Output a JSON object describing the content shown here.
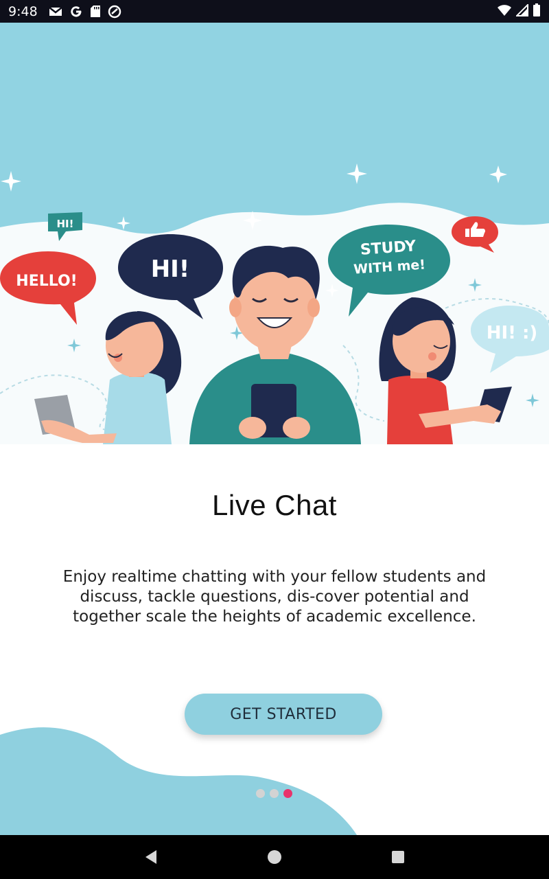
{
  "status_bar": {
    "time": "9:48",
    "left_icons": [
      "gmail-icon",
      "google-icon",
      "sd-card-icon",
      "sync-icon"
    ],
    "right_icons": [
      "wifi-icon",
      "signal-icon",
      "battery-icon"
    ]
  },
  "hero": {
    "bubbles": {
      "hello": "HELLO!",
      "hi_small": "HI!",
      "hi_big": "HI!",
      "study_line1": "STUDY",
      "study_line2": "WITH me!",
      "hi_smile": "HI! :)"
    },
    "icons": [
      "thumbs-up-icon"
    ]
  },
  "onboarding": {
    "title": "Live Chat",
    "description": "Enjoy realtime chatting with your fellow students and discuss, tackle questions, dis-cover potential and together scale the heights of academic excellence.",
    "button_label": "GET STARTED",
    "page_indicator": {
      "count": 3,
      "active_index": 2
    }
  },
  "colors": {
    "sky": "#91d3e2",
    "accent": "#8fd0df",
    "active_dot": "#e8336b",
    "inactive_dot": "#d3d3d3",
    "bubble_red": "#e5403b",
    "bubble_navy": "#1f2a4e",
    "bubble_teal": "#2a8e8a"
  },
  "nav_bar": {
    "icons": [
      "back-icon",
      "home-icon",
      "recents-icon"
    ]
  }
}
